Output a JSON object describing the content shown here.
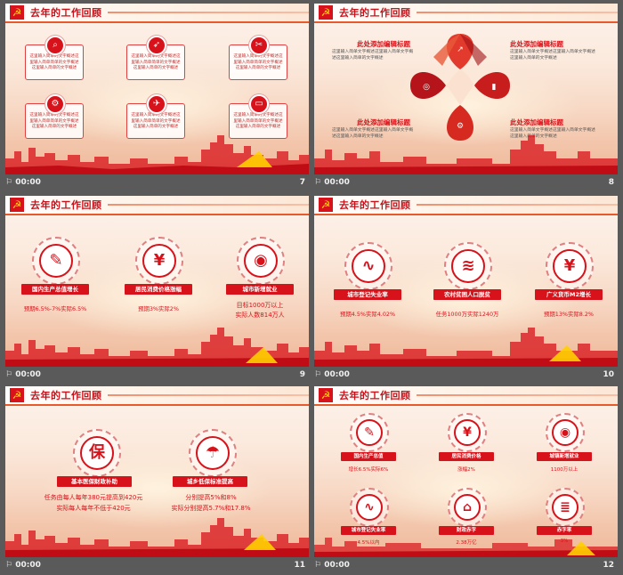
{
  "slides": [
    {
      "title": "去年的工作回顾",
      "time": "00:00",
      "number": "7",
      "box_text": "这里输入简单的文字概述这里输入简单简单的文字概述这里输入简单的文字概述",
      "icons": [
        "search-icon",
        "rocket-icon",
        "tools-icon",
        "gear-icon",
        "paper-plane-icon",
        "monitor-icon"
      ]
    },
    {
      "title": "去年的工作回顾",
      "time": "00:00",
      "number": "8",
      "headings": [
        "此处添加编辑标题",
        "此处添加编辑标题",
        "此处添加编辑标题",
        "此处添加编辑标题"
      ],
      "desc": "这里输入简单文字概述这里输入简单文字概述这里输入简单的文字概述"
    },
    {
      "title": "去年的工作回顾",
      "time": "00:00",
      "number": "9",
      "items": [
        {
          "label": "国内生产总值增长",
          "note": "预期6.5%-7%实际6.5%"
        },
        {
          "label": "居民消费价格涨幅",
          "note": "预期3%实际2%"
        },
        {
          "label": "城市新增就业",
          "note": "目标1000万以上",
          "note2": "实际人数814万人"
        }
      ]
    },
    {
      "title": "去年的工作回顾",
      "time": "00:00",
      "number": "10",
      "items": [
        {
          "label": "城市登记失业率",
          "note": "预期4.5%实际4.02%"
        },
        {
          "label": "农村贫困人口脱贫",
          "note": "任务1000万实际1240万"
        },
        {
          "label": "广义货币M2增长",
          "note": "预期13%实际8.2%"
        }
      ]
    },
    {
      "title": "去年的工作回顾",
      "time": "00:00",
      "number": "11",
      "items": [
        {
          "label": "基本医保财政补助",
          "note": "任务由每人每年380元提高到420元",
          "note2": "实际每人每年不低于420元"
        },
        {
          "label": "城乡低保标准提高",
          "note": "分别提高5%和8%",
          "note2": "实际分别提高5.7%和17.8%"
        }
      ]
    },
    {
      "title": "去年的工作回顾",
      "time": "00:00",
      "number": "12",
      "items": [
        {
          "label": "国内生产总值",
          "note": "增长6.5%实际6%"
        },
        {
          "label": "居民消费价格",
          "note": "涨幅2%"
        },
        {
          "label": "城镇新增就业",
          "note": "1100万以上"
        },
        {
          "label": "城市登记失业率",
          "note": "4.5%以内"
        },
        {
          "label": "财政赤字",
          "note": "2.38万亿"
        },
        {
          "label": "赤字率",
          "note": "3%"
        }
      ]
    }
  ]
}
